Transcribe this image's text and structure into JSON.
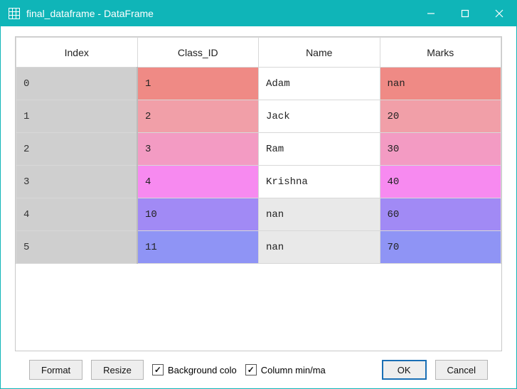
{
  "window": {
    "title": "final_dataframe - DataFrame"
  },
  "columns": [
    "Index",
    "Class_ID",
    "Name",
    "Marks"
  ],
  "rows": [
    {
      "index": "0",
      "class_id": "1",
      "name": "Adam",
      "marks": "nan"
    },
    {
      "index": "1",
      "class_id": "2",
      "name": "Jack",
      "marks": "20"
    },
    {
      "index": "2",
      "class_id": "3",
      "name": "Ram",
      "marks": "30"
    },
    {
      "index": "3",
      "class_id": "4",
      "name": "Krishna",
      "marks": "40"
    },
    {
      "index": "4",
      "class_id": "10",
      "name": "nan",
      "marks": "60"
    },
    {
      "index": "5",
      "class_id": "11",
      "name": "nan",
      "marks": "70"
    }
  ],
  "buttons": {
    "format": "Format",
    "resize": "Resize",
    "ok": "OK",
    "cancel": "Cancel"
  },
  "checks": {
    "bg": {
      "label": "Background colo",
      "checked": true
    },
    "minmax": {
      "label": "Column min/ma",
      "checked": true
    }
  }
}
